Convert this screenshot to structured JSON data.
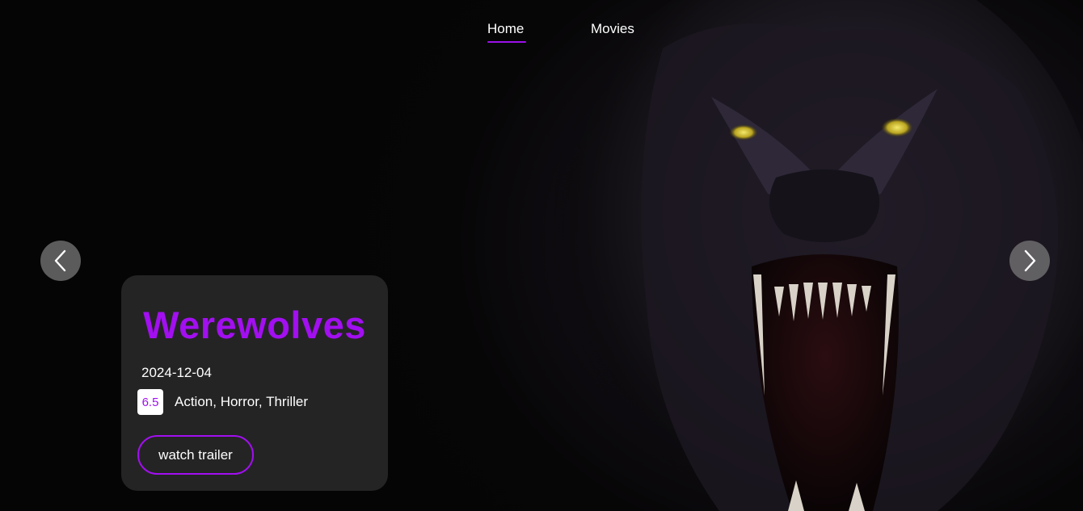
{
  "nav": {
    "items": [
      {
        "label": "Home",
        "active": true
      },
      {
        "label": "Movies",
        "active": false
      }
    ],
    "active_color": "#9b10e8"
  },
  "carousel": {
    "prev_icon": "chevron-left-icon",
    "next_icon": "chevron-right-icon"
  },
  "featured": {
    "title": "Werewolves",
    "release_date": "2024-12-04",
    "rating": "6.5",
    "genres": "Action, Horror, Thriller",
    "trailer_button": "watch trailer",
    "accent_color": "#a20ff0"
  },
  "hero_image": "werewolf-face-poster"
}
